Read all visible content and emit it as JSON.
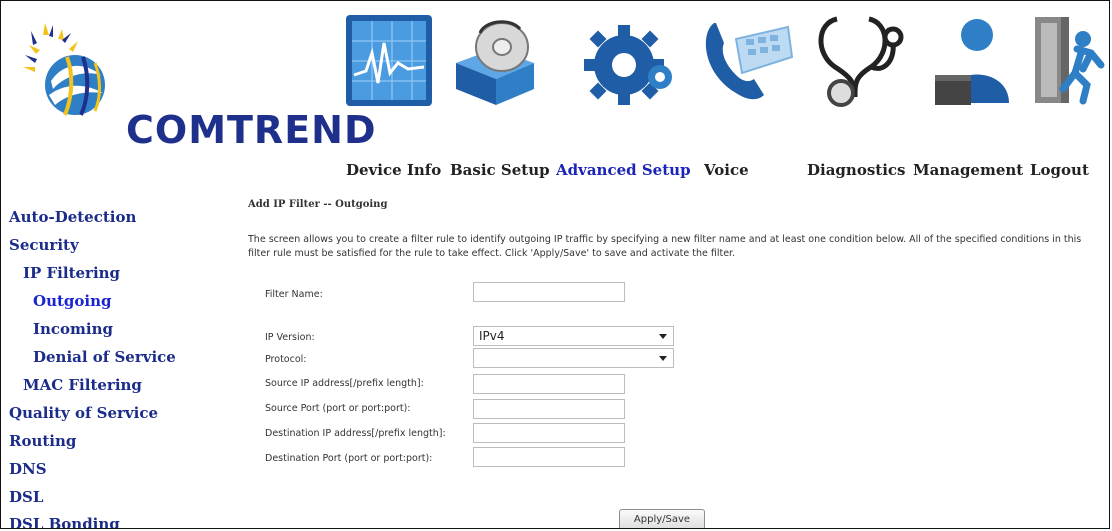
{
  "brand": {
    "name": "COMTREND"
  },
  "nav": [
    {
      "label": "Device Info",
      "icon": "device-info-chart-icon"
    },
    {
      "label": "Basic Setup",
      "icon": "basic-setup-box-disc-icon"
    },
    {
      "label": "Advanced Setup",
      "icon": "advanced-setup-gear-icon",
      "active": true
    },
    {
      "label": "Voice",
      "icon": "voice-phone-icon"
    },
    {
      "label": "Diagnostics",
      "icon": "diagnostics-stethoscope-icon"
    },
    {
      "label": "Management",
      "icon": "management-person-icon"
    },
    {
      "label": "Logout",
      "icon": "logout-running-man-icon"
    }
  ],
  "sidebar": [
    {
      "label": "Auto-Detection"
    },
    {
      "label": "Security"
    },
    {
      "label": "IP Filtering"
    },
    {
      "label": "Outgoing",
      "selected": true
    },
    {
      "label": "Incoming"
    },
    {
      "label": "Denial of Service"
    },
    {
      "label": "MAC Filtering"
    },
    {
      "label": "Quality of Service"
    },
    {
      "label": "Routing"
    },
    {
      "label": "DNS"
    },
    {
      "label": "DSL"
    },
    {
      "label": "DSL Bonding"
    }
  ],
  "page": {
    "title": "Add IP Filter -- Outgoing",
    "description": "The screen allows you to create a filter rule to identify outgoing IP traffic by specifying a new filter name and at least one condition below. All of the specified conditions in this filter rule must be satisfied for the rule to take effect. Click 'Apply/Save' to save and activate the filter."
  },
  "form": {
    "filter_name": {
      "label": "Filter Name:",
      "value": ""
    },
    "ip_version": {
      "label": "IP Version:",
      "value": "IPv4"
    },
    "protocol": {
      "label": "Protocol:",
      "value": ""
    },
    "source_ip": {
      "label": "Source IP address[/prefix length]:",
      "value": ""
    },
    "source_port": {
      "label": "Source Port (port or port:port):",
      "value": ""
    },
    "dest_ip": {
      "label": "Destination IP address[/prefix length]:",
      "value": ""
    },
    "dest_port": {
      "label": "Destination Port (port or port:port):",
      "value": ""
    },
    "apply_label": "Apply/Save"
  },
  "colors": {
    "brand_blue": "#1f2f8c",
    "nav_active": "#1a24b8",
    "sidebar_text": "#1c2c8a",
    "sidebar_selected": "#1a24d0"
  }
}
